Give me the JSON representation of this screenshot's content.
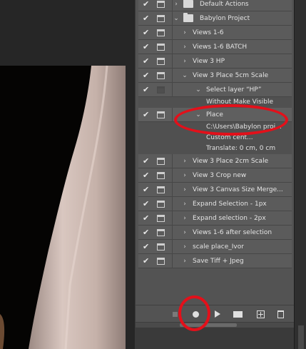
{
  "actions_panel": {
    "rows": [
      {
        "type": "set",
        "label": "Default Actions",
        "check": "✔",
        "expanded": false
      },
      {
        "type": "set",
        "label": "Babylon Project",
        "check": "✔",
        "expanded": true
      },
      {
        "type": "action",
        "label": "Views 1-6",
        "check": "✔"
      },
      {
        "type": "action",
        "label": "Views 1-6 BATCH",
        "check": "✔"
      },
      {
        "type": "action",
        "label": "View 3 HP",
        "check": "✔"
      },
      {
        "type": "action",
        "label": "View 3 Place 5cm Scale",
        "check": "✔",
        "expanded": true
      },
      {
        "type": "step",
        "label": "Select layer “HP”",
        "check": "✔",
        "expanded": true
      },
      {
        "type": "detail",
        "label": "Without Make Visible"
      },
      {
        "type": "step",
        "label": "Place",
        "check": "✔",
        "expanded": true,
        "selected": true
      },
      {
        "type": "detail",
        "label": "C:\\Users\\Babylon proj..."
      },
      {
        "type": "detail",
        "label": "Custom  cent..."
      },
      {
        "type": "detail",
        "label": "Translate: 0 cm, 0 cm"
      },
      {
        "type": "action",
        "label": "View 3 Place 2cm Scale",
        "check": "✔"
      },
      {
        "type": "action",
        "label": "View 3 Crop new",
        "check": "✔"
      },
      {
        "type": "action",
        "label": "View 3 Canvas Size Merge...",
        "check": "✔"
      },
      {
        "type": "action",
        "label": "Expand Selection - 1px",
        "check": "✔"
      },
      {
        "type": "action",
        "label": "Expand selection - 2px",
        "check": "✔"
      },
      {
        "type": "action",
        "label": "Views 1-6 after selection",
        "check": "✔"
      },
      {
        "type": "action",
        "label": "scale place_Ivor",
        "check": "✔"
      },
      {
        "type": "action",
        "label": "Save Tiff + Jpeg",
        "check": "✔"
      }
    ]
  },
  "toolbar": {
    "stop_icon": "stop-icon",
    "record_icon": "record-icon",
    "play_icon": "play-icon",
    "folder_icon": "new-set-icon",
    "new_icon": "new-action-icon",
    "trash_icon": "trash-icon"
  },
  "colors": {
    "panel_bg": "#535353",
    "annotation": "#e3101a"
  }
}
